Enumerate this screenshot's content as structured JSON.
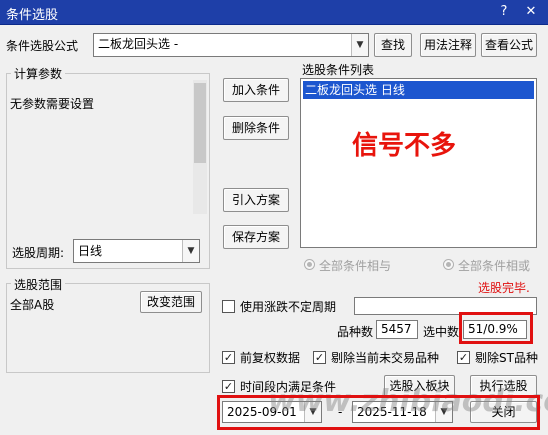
{
  "window": {
    "title": "条件选股"
  },
  "formula_row": {
    "label": "条件选股公式",
    "formula_value": "二板龙回头选  -",
    "find_button": "查找",
    "usage_button": "用法注释",
    "view_formula_button": "查看公式"
  },
  "params": {
    "group_label": "计算参数",
    "no_params_text": "无参数需要设置",
    "period_label": "选股周期:",
    "period_value": "日线"
  },
  "conditions": {
    "buttons": {
      "add": "加入条件",
      "remove": "删除条件",
      "import": "引入方案",
      "save": "保存方案"
    },
    "list_label": "选股条件列表",
    "items": [
      "二板龙回头选  日线"
    ],
    "annotation": "信号不多",
    "radio_all_and": "全部条件相与",
    "radio_all_or": "全部条件相或",
    "status": "选股完毕."
  },
  "scope": {
    "group_label": "选股范围",
    "value": "全部A股",
    "change_button": "改变范围"
  },
  "options": {
    "use_variable_period": "使用涨跌不定周期",
    "variable_period_value": "",
    "count_label": "品种数",
    "count_value": "5457",
    "selected_label": "选中数",
    "selected_value": "51/0.9%",
    "forward_adjust": "前复权数据",
    "exclude_untraded": "剔除当前未交易品种",
    "exclude_st": "剔除ST品种",
    "period_satisfy": "时间段内满足条件"
  },
  "dates": {
    "start": "2025-09-01",
    "separator": "-",
    "end": "2025-11-18"
  },
  "actions": {
    "to_block": "选股入板块",
    "execute": "执行选股",
    "close": "关闭"
  },
  "watermark": "www.zhibiaodi.com",
  "colors": {
    "title_bar": "#1e3fa8",
    "selection": "#1c56cf",
    "annotation": "#e8140c",
    "status": "#e01010",
    "highlight_box": "#e01010"
  }
}
